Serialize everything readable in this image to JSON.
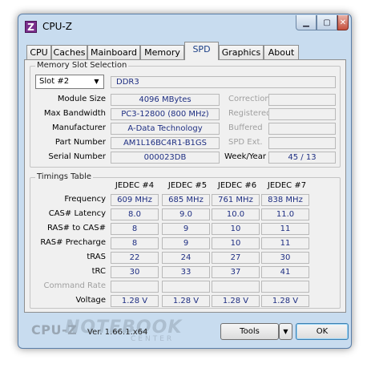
{
  "window": {
    "title": "CPU-Z",
    "icon_letter": "Z",
    "controls": {
      "minimize": "▁",
      "maximize": "▢",
      "close": "✕"
    }
  },
  "tabs": [
    "CPU",
    "Caches",
    "Mainboard",
    "Memory",
    "SPD",
    "Graphics",
    "About"
  ],
  "active_tab": "SPD",
  "slot_section": {
    "title": "Memory Slot Selection",
    "slot_value": "Slot #2",
    "memory_type": "DDR3",
    "rows": [
      {
        "label": "Module Size",
        "value": "4096 MBytes",
        "right_label": "Correction",
        "right_value": ""
      },
      {
        "label": "Max Bandwidth",
        "value": "PC3-12800 (800 MHz)",
        "right_label": "Registered",
        "right_value": ""
      },
      {
        "label": "Manufacturer",
        "value": "A-Data Technology",
        "right_label": "Buffered",
        "right_value": ""
      },
      {
        "label": "Part Number",
        "value": "AM1L16BC4R1-B1GS",
        "right_label": "SPD Ext.",
        "right_value": ""
      },
      {
        "label": "Serial Number",
        "value": "000023DB",
        "right_label": "Week/Year",
        "right_value": "45 / 13"
      }
    ]
  },
  "timings": {
    "title": "Timings Table",
    "columns": [
      "JEDEC #4",
      "JEDEC #5",
      "JEDEC #6",
      "JEDEC #7"
    ],
    "rows": [
      {
        "label": "Frequency",
        "values": [
          "609 MHz",
          "685 MHz",
          "761 MHz",
          "838 MHz"
        ]
      },
      {
        "label": "CAS# Latency",
        "values": [
          "8.0",
          "9.0",
          "10.0",
          "11.0"
        ]
      },
      {
        "label": "RAS# to CAS#",
        "values": [
          "8",
          "9",
          "10",
          "11"
        ]
      },
      {
        "label": "RAS# Precharge",
        "values": [
          "8",
          "9",
          "10",
          "11"
        ]
      },
      {
        "label": "tRAS",
        "values": [
          "22",
          "24",
          "27",
          "30"
        ]
      },
      {
        "label": "tRC",
        "values": [
          "30",
          "33",
          "37",
          "41"
        ]
      },
      {
        "label": "Command Rate",
        "values": [
          "",
          "",
          "",
          ""
        ]
      },
      {
        "label": "Voltage",
        "values": [
          "1.28 V",
          "1.28 V",
          "1.28 V",
          "1.28 V"
        ]
      }
    ]
  },
  "footer": {
    "brand": "CPU-Z",
    "version": "Ver. 1.66.1.x64",
    "watermark": "NOTEBOOK",
    "watermark_sub": "CENTER",
    "tools_label": "Tools",
    "ok_label": "OK",
    "dropdown_arrow": "▼"
  }
}
